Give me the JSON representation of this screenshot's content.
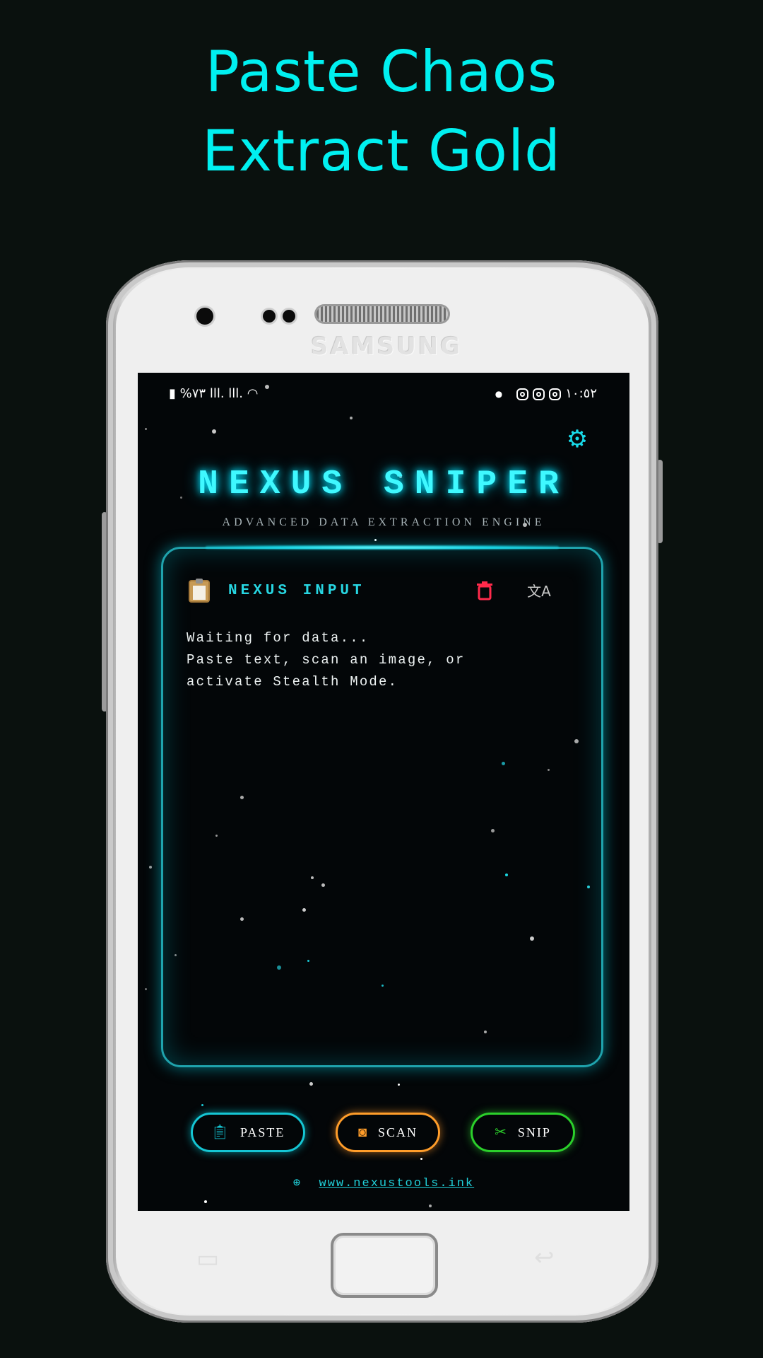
{
  "promo": {
    "headline_line1": "Paste Chaos",
    "headline_line2": "Extract Gold"
  },
  "device": {
    "brand": "SAMSUNG"
  },
  "status_bar": {
    "left": "%٧٣ lll. lll.",
    "time": "١٠:٥٢"
  },
  "app": {
    "title": "NEXUS SNIPER",
    "subtitle": "ADVANCED DATA EXTRACTION ENGINE",
    "input_panel": {
      "label": "NEXUS INPUT",
      "placeholder": "Waiting for data...\nPaste text, scan an image, or\nactivate Stealth Mode."
    },
    "buttons": {
      "paste": "PASTE",
      "scan": "SCAN",
      "snip": "SNIP"
    },
    "website": "www.nexustools.ink"
  },
  "colors": {
    "accent_cyan": "#00f0f0",
    "scan_orange": "#ff9d2a",
    "snip_green": "#2bd02b",
    "delete_red": "#ff2a4b"
  },
  "icons": [
    "settings-gear-icon",
    "clipboard-icon",
    "trash-icon",
    "translate-icon",
    "paste-icon",
    "camera-icon",
    "scissors-icon",
    "globe-icon",
    "instagram-icon",
    "battery-icon",
    "signal-icon",
    "wifi-icon"
  ]
}
